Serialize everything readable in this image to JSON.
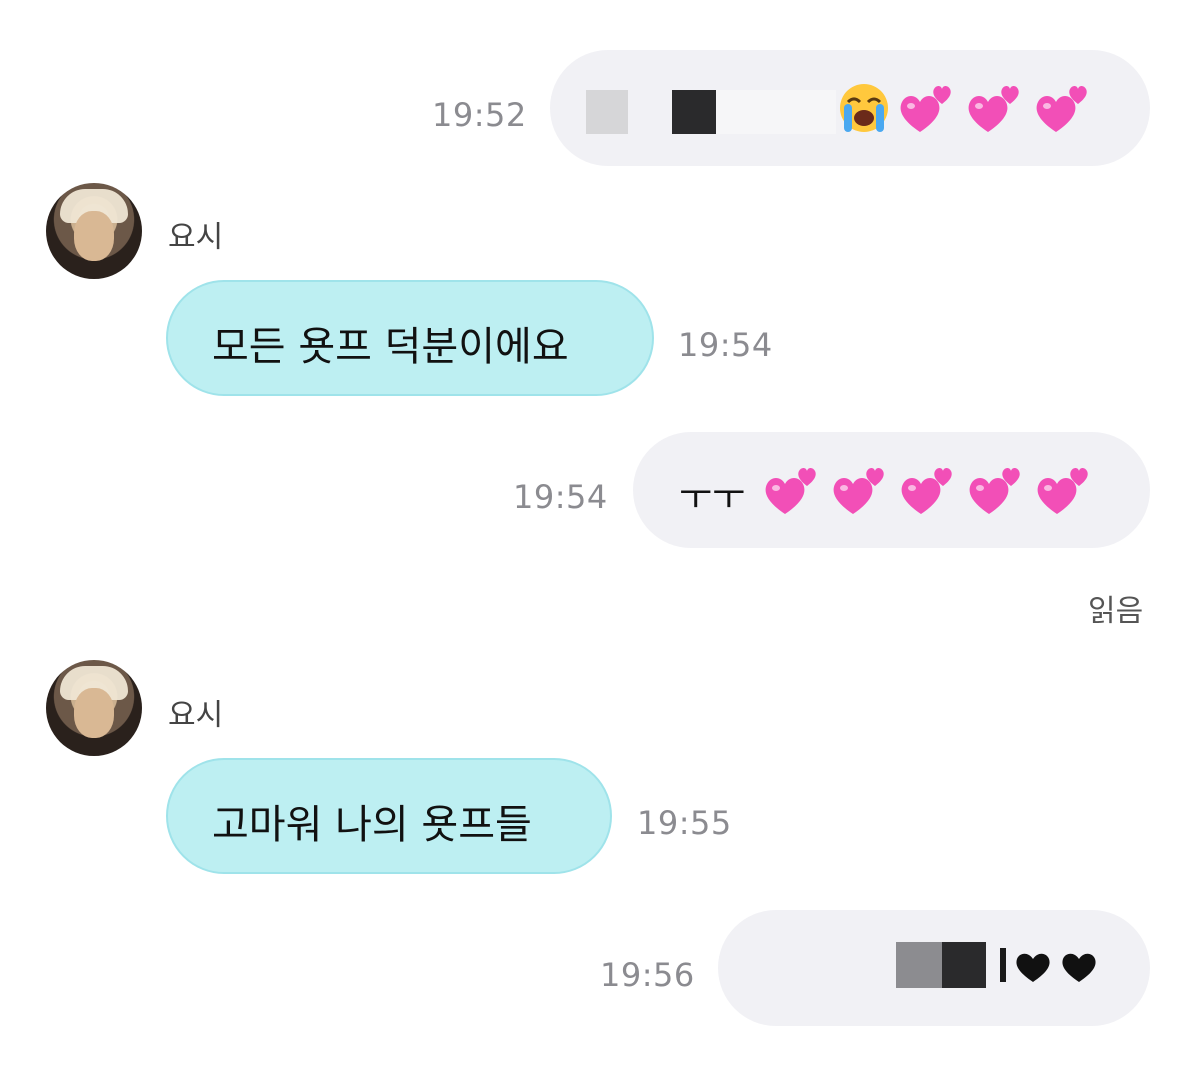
{
  "messages": [
    {
      "side": "out",
      "time": "19:52"
    },
    {
      "side": "in",
      "sender": "요시",
      "text": "모든 욧프 덕분이에요",
      "time": "19:54"
    },
    {
      "side": "out",
      "text": "ㅜㅜ",
      "time": "19:54"
    },
    {
      "side": "in",
      "sender": "요시",
      "text": "고마워 나의 욧프들",
      "time": "19:55"
    },
    {
      "side": "out",
      "time": "19:56"
    }
  ],
  "read_receipt": "읽음",
  "colors": {
    "incoming_bubble": "#bdeff2",
    "outgoing_bubble": "#f1f1f5",
    "heart_pink": "#f24fb7"
  }
}
